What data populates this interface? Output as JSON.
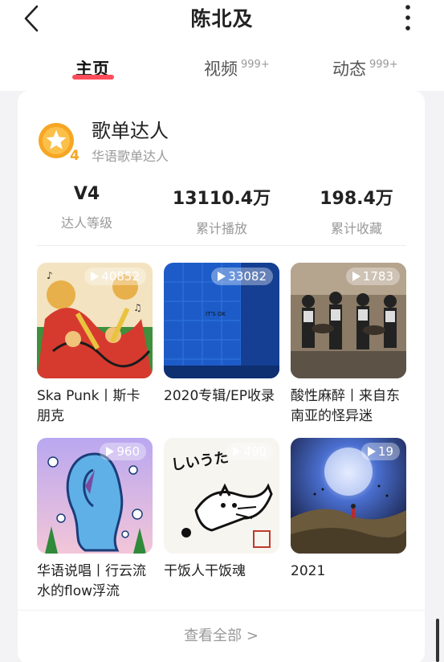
{
  "header": {
    "title": "陈北及",
    "tabs": [
      {
        "label": "主页",
        "count": ""
      },
      {
        "label": "视频",
        "count": "999+"
      },
      {
        "label": "动态",
        "count": "999+"
      }
    ]
  },
  "profile_card": {
    "badge_level": "4",
    "title": "歌单达人",
    "subtitle": "华语歌单达人",
    "stats": [
      {
        "value": "V4",
        "label": "达人等级"
      },
      {
        "value": "13110.4万",
        "label": "累计播放"
      },
      {
        "value": "198.4万",
        "label": "累计收藏"
      }
    ],
    "playlists": [
      {
        "name": "Ska Punk丨斯卡朋克",
        "plays": "40852",
        "cover_text": ""
      },
      {
        "name": "2020专辑/EP收录",
        "plays": "33082",
        "cover_text": "IT'S OK"
      },
      {
        "name": "酸性麻醉丨来自东南亚的怪异迷",
        "plays": "1783",
        "cover_text": ""
      },
      {
        "name": "华语说唱丨行云流水的flow浮流",
        "plays": "960",
        "cover_text": ""
      },
      {
        "name": "干饭人干饭魂",
        "plays": "490",
        "cover_text": "しいうた"
      },
      {
        "name": "2021",
        "plays": "19",
        "cover_text": ""
      }
    ],
    "see_all": "查看全部 >"
  },
  "colors": {
    "accent": "#ff4d5a",
    "badge": "#f6a623"
  }
}
